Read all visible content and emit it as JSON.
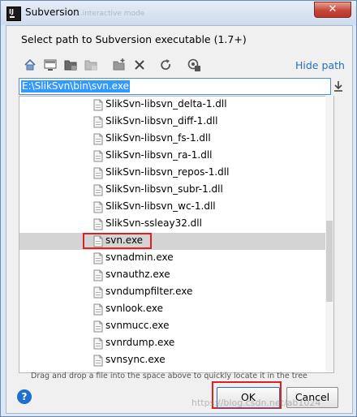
{
  "window": {
    "title": "Subversion",
    "ghost_text": "...interactive mode",
    "close_glyph": "✕"
  },
  "dialog": {
    "header": "Select path to Subversion executable (1.7+)",
    "hide_path_label": "Hide path",
    "path_value": "E:\\SlikSvn\\bin\\svn.exe",
    "hint": "Drag and drop a file into the space above to quickly locate it in the tree"
  },
  "toolbar": {
    "icons": [
      "home-icon",
      "desktop-icon",
      "project-folder-icon",
      "module-folder-icon",
      "new-folder-icon",
      "delete-icon",
      "refresh-icon",
      "show-hidden-icon"
    ]
  },
  "tree": {
    "items": [
      {
        "label": "SlikSvn-libsvn_delta-1.dll",
        "selected": false
      },
      {
        "label": "SlikSvn-libsvn_diff-1.dll",
        "selected": false
      },
      {
        "label": "SlikSvn-libsvn_fs-1.dll",
        "selected": false
      },
      {
        "label": "SlikSvn-libsvn_ra-1.dll",
        "selected": false
      },
      {
        "label": "SlikSvn-libsvn_repos-1.dll",
        "selected": false
      },
      {
        "label": "SlikSvn-libsvn_subr-1.dll",
        "selected": false
      },
      {
        "label": "SlikSvn-libsvn_wc-1.dll",
        "selected": false
      },
      {
        "label": "SlikSvn-ssleay32.dll",
        "selected": false
      },
      {
        "label": "svn.exe",
        "selected": true
      },
      {
        "label": "svnadmin.exe",
        "selected": false
      },
      {
        "label": "svnauthz.exe",
        "selected": false
      },
      {
        "label": "svndumpfilter.exe",
        "selected": false
      },
      {
        "label": "svnlook.exe",
        "selected": false
      },
      {
        "label": "svnmucc.exe",
        "selected": false
      },
      {
        "label": "svnrdump.exe",
        "selected": false
      },
      {
        "label": "svnsync.exe",
        "selected": false
      }
    ]
  },
  "buttons": {
    "help": "?",
    "ok": "OK",
    "cancel": "Cancel"
  },
  "watermark": "https://blog.csdn.net/ab1024",
  "colors": {
    "link": "#2470c2",
    "selection": "#3399ff",
    "highlight_box": "#e02020"
  }
}
